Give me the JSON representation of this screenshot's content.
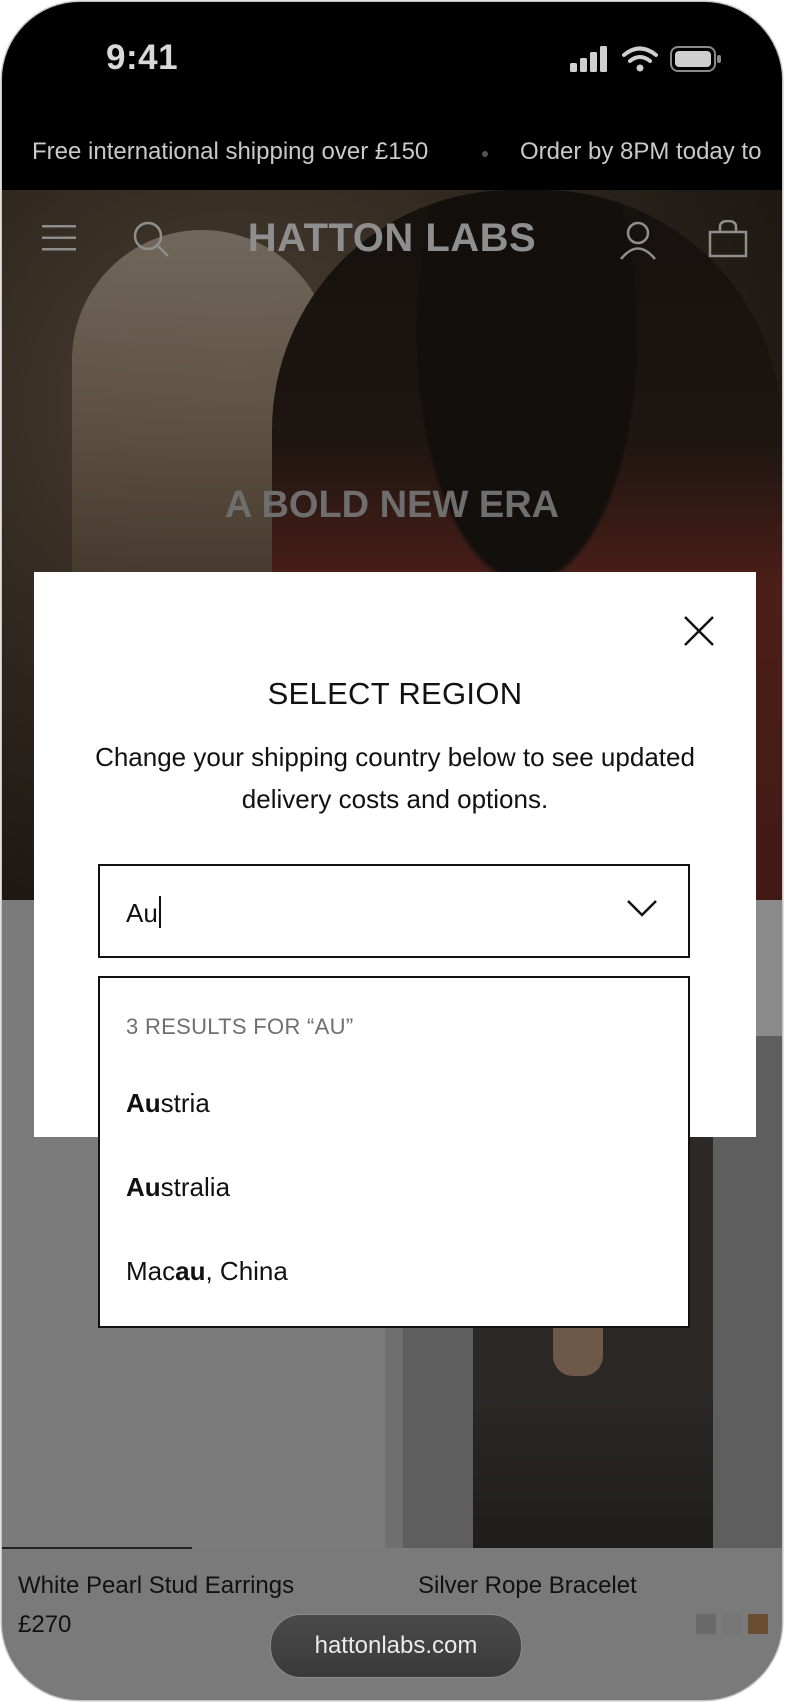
{
  "status_bar": {
    "time": "9:41"
  },
  "announcement": {
    "messages": [
      "Free international shipping over £150",
      "Order by 8PM today to"
    ]
  },
  "header": {
    "brand": "HATTON LABS"
  },
  "hero": {
    "title": "A BOLD NEW ERA"
  },
  "modal": {
    "title": "SELECT REGION",
    "description": "Change your shipping country below to see updated delivery costs and options.",
    "search": {
      "value": "Au"
    },
    "results_header": "3 RESULTS FOR “AU”",
    "results": [
      {
        "match": "Au",
        "rest": "stria"
      },
      {
        "match": "Au",
        "rest": "stralia"
      },
      {
        "prefix": "Mac",
        "match": "au",
        "rest": ", China"
      }
    ]
  },
  "products": [
    {
      "name": "White Pearl Stud Earrings",
      "price": "£270"
    },
    {
      "name": "Silver Rope Bracelet"
    }
  ],
  "swatch_colors": [
    "#6a6a6a",
    "#777777",
    "#6b4e32"
  ],
  "browser": {
    "url": "hattonlabs.com"
  }
}
